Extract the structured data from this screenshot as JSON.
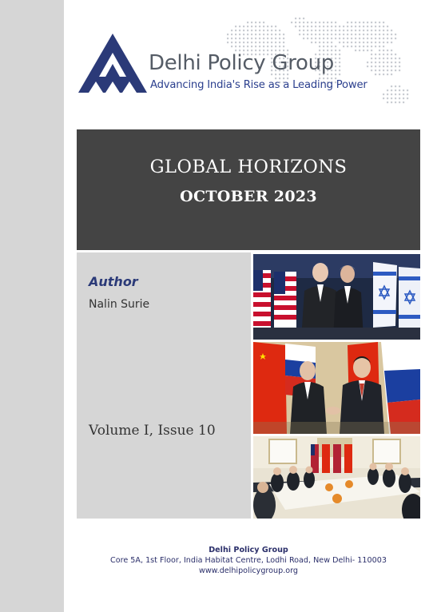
{
  "header": {
    "org_name": "Delhi Policy Group",
    "tagline": "Advancing India's Rise as a Leading Power"
  },
  "title_band": {
    "series_title": "GLOBAL HORIZONS",
    "issue_date": "OCTOBER 2023"
  },
  "info_panel": {
    "author_heading": "Author",
    "author_name": "Nalin Surie",
    "volume_issue": "Volume I, Issue 10"
  },
  "footer": {
    "org_name": "Delhi Policy Group",
    "address": "Core 5A, 1st Floor, India Habitat Centre, Lodhi Road, New Delhi- 110003",
    "website": "www.delhipolicygroup.org"
  },
  "colors": {
    "brand_navy": "#2b3a78",
    "title_band": "#444444",
    "panel_grey": "#d6d6d6"
  }
}
